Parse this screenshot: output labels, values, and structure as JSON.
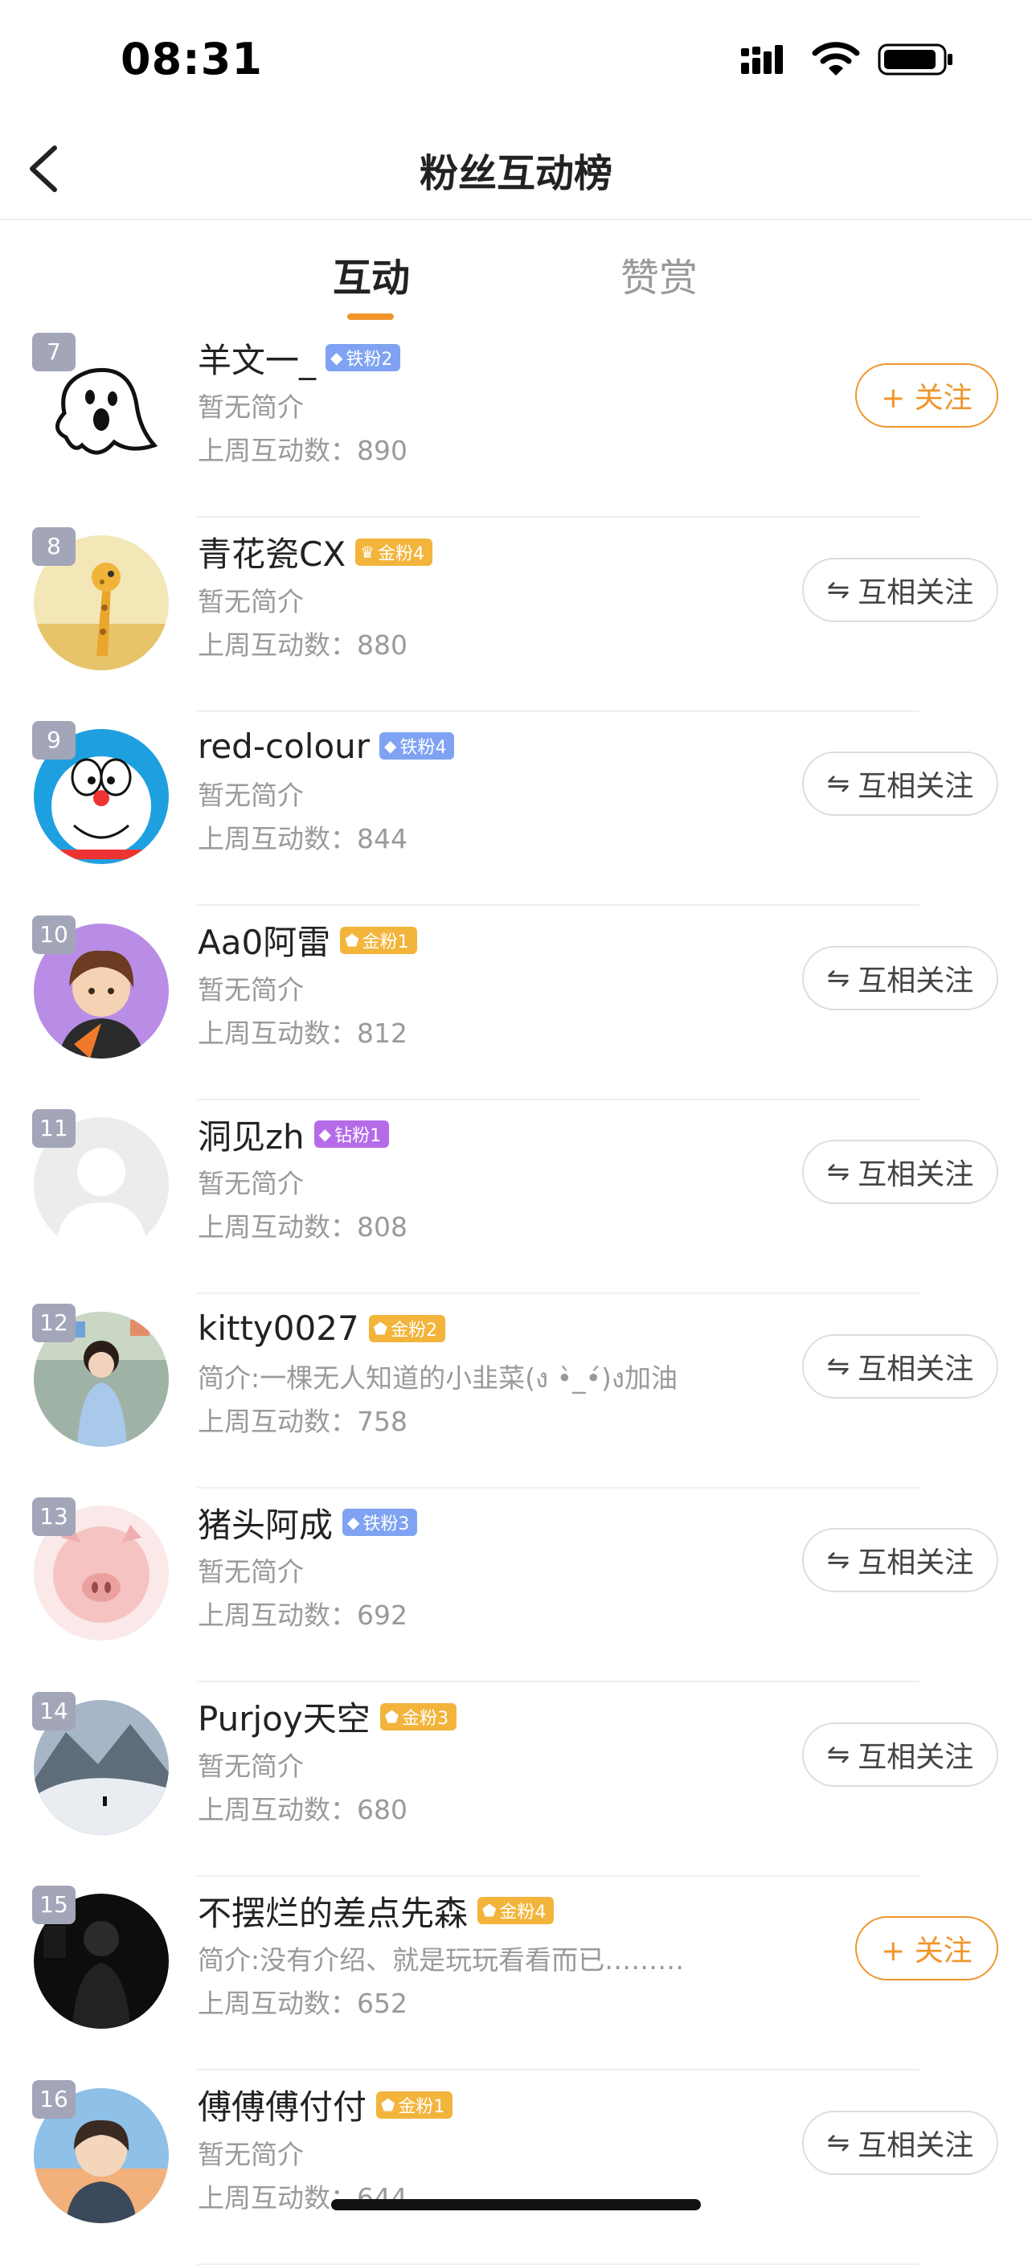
{
  "status_bar": {
    "time": "08:31"
  },
  "header": {
    "title": "粉丝互动榜"
  },
  "tabs": [
    {
      "label": "互动",
      "active": true
    },
    {
      "label": "赞赏",
      "active": false
    }
  ],
  "colors": {
    "accent": "#f0952a",
    "rank_badge": "#a3a5b8",
    "badge_tie": "#7fa3f2",
    "badge_jin": "#f3b43c",
    "badge_zuan": "#b56be8"
  },
  "fans": [
    {
      "rank": "7",
      "name": "羊文一_",
      "badge": "铁粉2",
      "badge_type": "tie",
      "badge_icon": "diamond-icon",
      "bio": "暂无简介",
      "stat": "上周互动数：890",
      "button": "+ 关注",
      "button_type": "follow",
      "avatar": "ghost-sketch-avatar"
    },
    {
      "rank": "8",
      "name": "青花瓷CX",
      "badge": "金粉4",
      "badge_type": "jin",
      "badge_icon": "crown-icon",
      "bio": "暂无简介",
      "stat": "上周互动数：880",
      "button": "互相关注",
      "button_type": "mutual",
      "avatar": "giraffe-avatar"
    },
    {
      "rank": "9",
      "name": "red-colour",
      "badge": "铁粉4",
      "badge_type": "tie",
      "badge_icon": "diamond-icon",
      "bio": "暂无简介",
      "stat": "上周互动数：844",
      "button": "互相关注",
      "button_type": "mutual",
      "avatar": "doraemon-avatar"
    },
    {
      "rank": "10",
      "name": "Aa0阿雷",
      "badge": "金粉1",
      "badge_type": "jin",
      "badge_icon": "pentagon-icon",
      "bio": "暂无简介",
      "stat": "上周互动数：812",
      "button": "互相关注",
      "button_type": "mutual",
      "avatar": "anime-boy-avatar"
    },
    {
      "rank": "11",
      "name": "洞见zh",
      "badge": "钻粉1",
      "badge_type": "zuan",
      "badge_icon": "diamond-icon",
      "bio": "暂无简介",
      "stat": "上周互动数：808",
      "button": "互相关注",
      "button_type": "mutual",
      "avatar": "default-avatar"
    },
    {
      "rank": "12",
      "name": "kitty0027",
      "badge": "金粉2",
      "badge_type": "jin",
      "badge_icon": "pentagon-icon",
      "bio": "简介:一棵无人知道的小韭菜(ง •̀_•́)ง加油",
      "stat": "上周互动数：758",
      "button": "互相关注",
      "button_type": "mutual",
      "avatar": "child-photo-avatar"
    },
    {
      "rank": "13",
      "name": "猪头阿成",
      "badge": "铁粉3",
      "badge_type": "tie",
      "badge_icon": "diamond-icon",
      "bio": "暂无简介",
      "stat": "上周互动数：692",
      "button": "互相关注",
      "button_type": "mutual",
      "avatar": "pig-avatar"
    },
    {
      "rank": "14",
      "name": "Purjoy天空",
      "badge": "金粉3",
      "badge_type": "jin",
      "badge_icon": "pentagon-icon",
      "bio": "暂无简介",
      "stat": "上周互动数：680",
      "button": "互相关注",
      "button_type": "mutual",
      "avatar": "snow-mountain-avatar"
    },
    {
      "rank": "15",
      "name": "不摆烂的差点先森",
      "badge": "金粉4",
      "badge_type": "jin",
      "badge_icon": "pentagon-icon",
      "bio": "简介:没有介绍、就是玩玩看看而已………",
      "stat": "上周互动数：652",
      "button": "+ 关注",
      "button_type": "follow",
      "avatar": "silhouette-avatar"
    },
    {
      "rank": "16",
      "name": "傅傅傅付付",
      "badge": "金粉1",
      "badge_type": "jin",
      "badge_icon": "pentagon-icon",
      "bio": "暂无简介",
      "stat": "上周互动数：644",
      "button": "互相关注",
      "button_type": "mutual",
      "avatar": "anime-sunset-avatar"
    }
  ]
}
